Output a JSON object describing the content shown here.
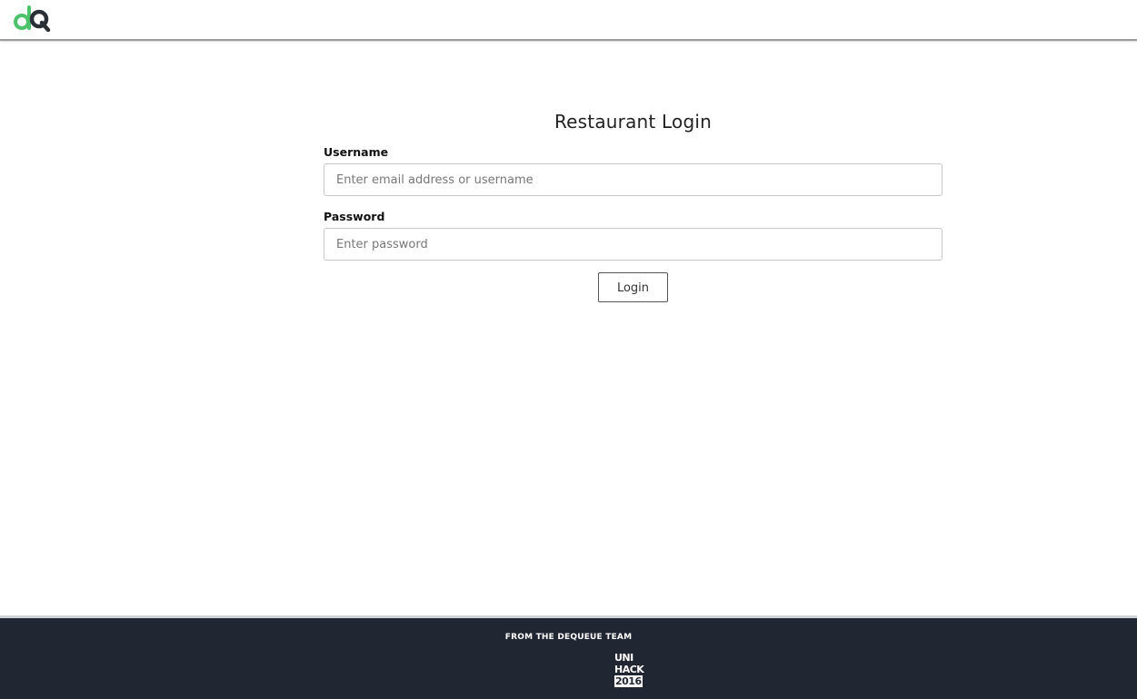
{
  "header": {
    "logo_alt": "dQ"
  },
  "main": {
    "title": "Restaurant Login",
    "username_label": "Username",
    "username_placeholder": "Enter email address or username",
    "username_value": "",
    "password_label": "Password",
    "password_placeholder": "Enter password",
    "password_value": "",
    "login_label": "Login"
  },
  "footer": {
    "tagline": "FROM THE DEQUEUE TEAM",
    "badge_line1": "UNI",
    "badge_line2": "HACK",
    "badge_line3": "2016"
  },
  "colors": {
    "logo_green": "#4cc36b",
    "logo_dark": "#2b2f36",
    "footer_bg": "#212633"
  }
}
